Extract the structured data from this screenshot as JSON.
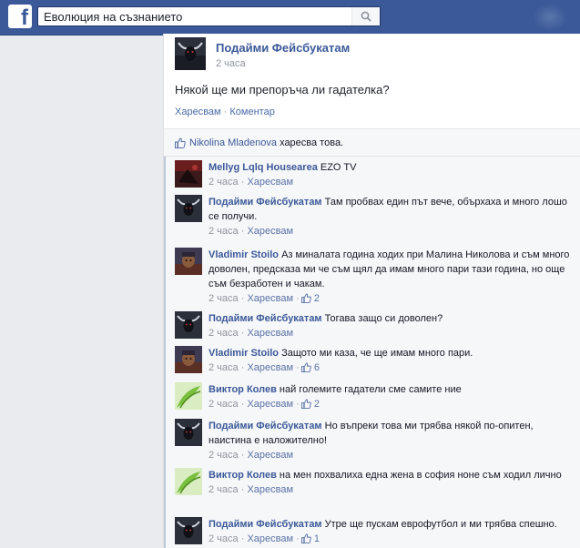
{
  "header": {
    "logo": "f",
    "search_value": "Еволюция на съзнанието"
  },
  "post": {
    "author": "Подайми Фейсбукатам",
    "time": "2 часа",
    "text": "Някой ще ми препоръча ли гадателка?",
    "like_action": "Харесвам",
    "separator": "·",
    "comment_action": "Коментар",
    "liker": "Nikolina Mladenova",
    "likes_suffix": "харесва това."
  },
  "comments": [
    {
      "author": "Mellyg Lqlq Housearea",
      "text": "EZO TV",
      "time": "2 часа",
      "like": "Харесвам",
      "likes": "",
      "avatar": "dark-red"
    },
    {
      "author": "Подайми Фейсбукатам",
      "text": "Там пробвах един път вече, обърхаха и много лошо се получи.",
      "time": "2 часа",
      "like": "Харесвам",
      "likes": "",
      "avatar": "bull"
    },
    {
      "author": "Vladimir Stoilo",
      "text": "Аз миналата година ходих при Малина Николова и съм много доволен, предсказа ми че съм щял да имам много пари тази година, но още съм безработен и чакам.",
      "time": "2 часа",
      "like": "Харесвам",
      "likes": "2",
      "avatar": "warrior"
    },
    {
      "author": "Подайми Фейсбукатам",
      "text": "Тогава защо си доволен?",
      "time": "2 часа",
      "like": "Харесвам",
      "likes": "",
      "avatar": "bull"
    },
    {
      "author": "Vladimir Stoilo",
      "text": "Защото ми каза, че ще имам много пари.",
      "time": "2 часа",
      "like": "Харесвам",
      "likes": "6",
      "avatar": "warrior"
    },
    {
      "author": "Виктор Колев",
      "text": "най големите гадатели сме самите ние",
      "time": "2 часа",
      "like": "Харесвам",
      "likes": "2",
      "avatar": "green"
    },
    {
      "author": "Подайми Фейсбукатам",
      "text": "Но въпреки това ми трябва някой по-опитен, наистина е наложително!",
      "time": "2 часа",
      "like": "Харесвам",
      "likes": "",
      "avatar": "bull"
    },
    {
      "author": "Виктор Колев",
      "text": "на мен похвалиха една жена в софия ноне съм ходил лично",
      "time": "2 часа",
      "like": "Харесвам",
      "likes": "",
      "avatar": "green"
    },
    {
      "author": "Подайми Фейсбукатам",
      "text": "Утре ще пускам еврофутбол и ми трябва спешно.",
      "time": "2 часа",
      "like": "Харесвам",
      "likes": "1",
      "avatar": "bull"
    }
  ]
}
